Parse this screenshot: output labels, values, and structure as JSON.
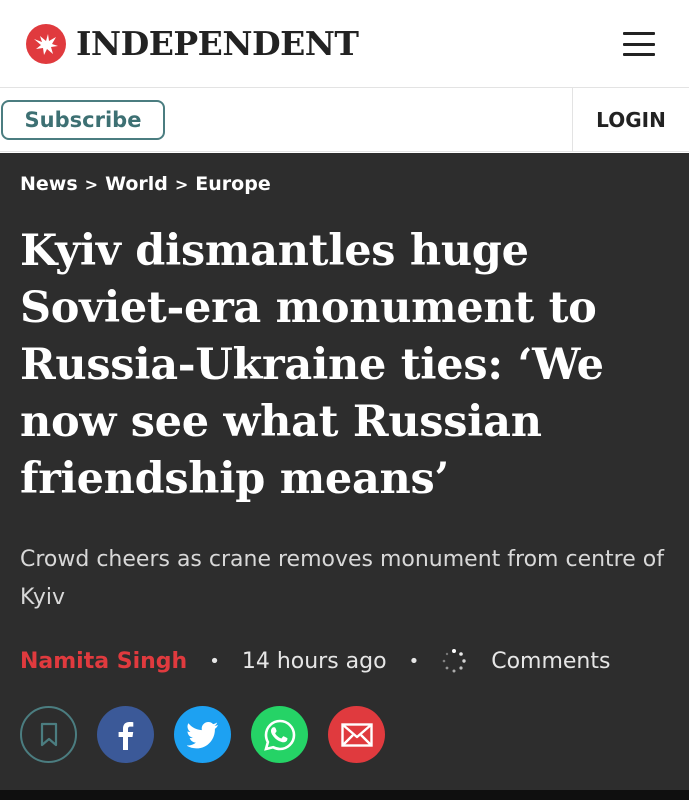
{
  "header": {
    "logo_text": "INDEPENDENT",
    "logo_icon": "eagle-icon",
    "menu_icon": "hamburger-menu-icon"
  },
  "account_bar": {
    "subscribe_label": "Subscribe",
    "login_label": "LOGIN"
  },
  "article": {
    "breadcrumb": [
      "News",
      "World",
      "Europe"
    ],
    "breadcrumb_separator": ">",
    "headline": "Kyiv dismantles huge Soviet-era monument to Russia-Ukraine ties: ‘We now see what Russian friendship means’",
    "standfirst": "Crowd cheers as crane removes monument from centre of Kyiv",
    "author": "Namita Singh",
    "timestamp": "14 hours ago",
    "comments_label": "Comments",
    "share_icons": [
      "bookmark-icon",
      "facebook-icon",
      "twitter-icon",
      "whatsapp-icon",
      "email-icon"
    ]
  },
  "colors": {
    "brand_red": "#e03a3e",
    "accent_teal": "#4b7d80",
    "article_bg": "#2d2d2d",
    "facebook": "#3b5998",
    "twitter": "#1da1f2",
    "whatsapp": "#25d366"
  }
}
